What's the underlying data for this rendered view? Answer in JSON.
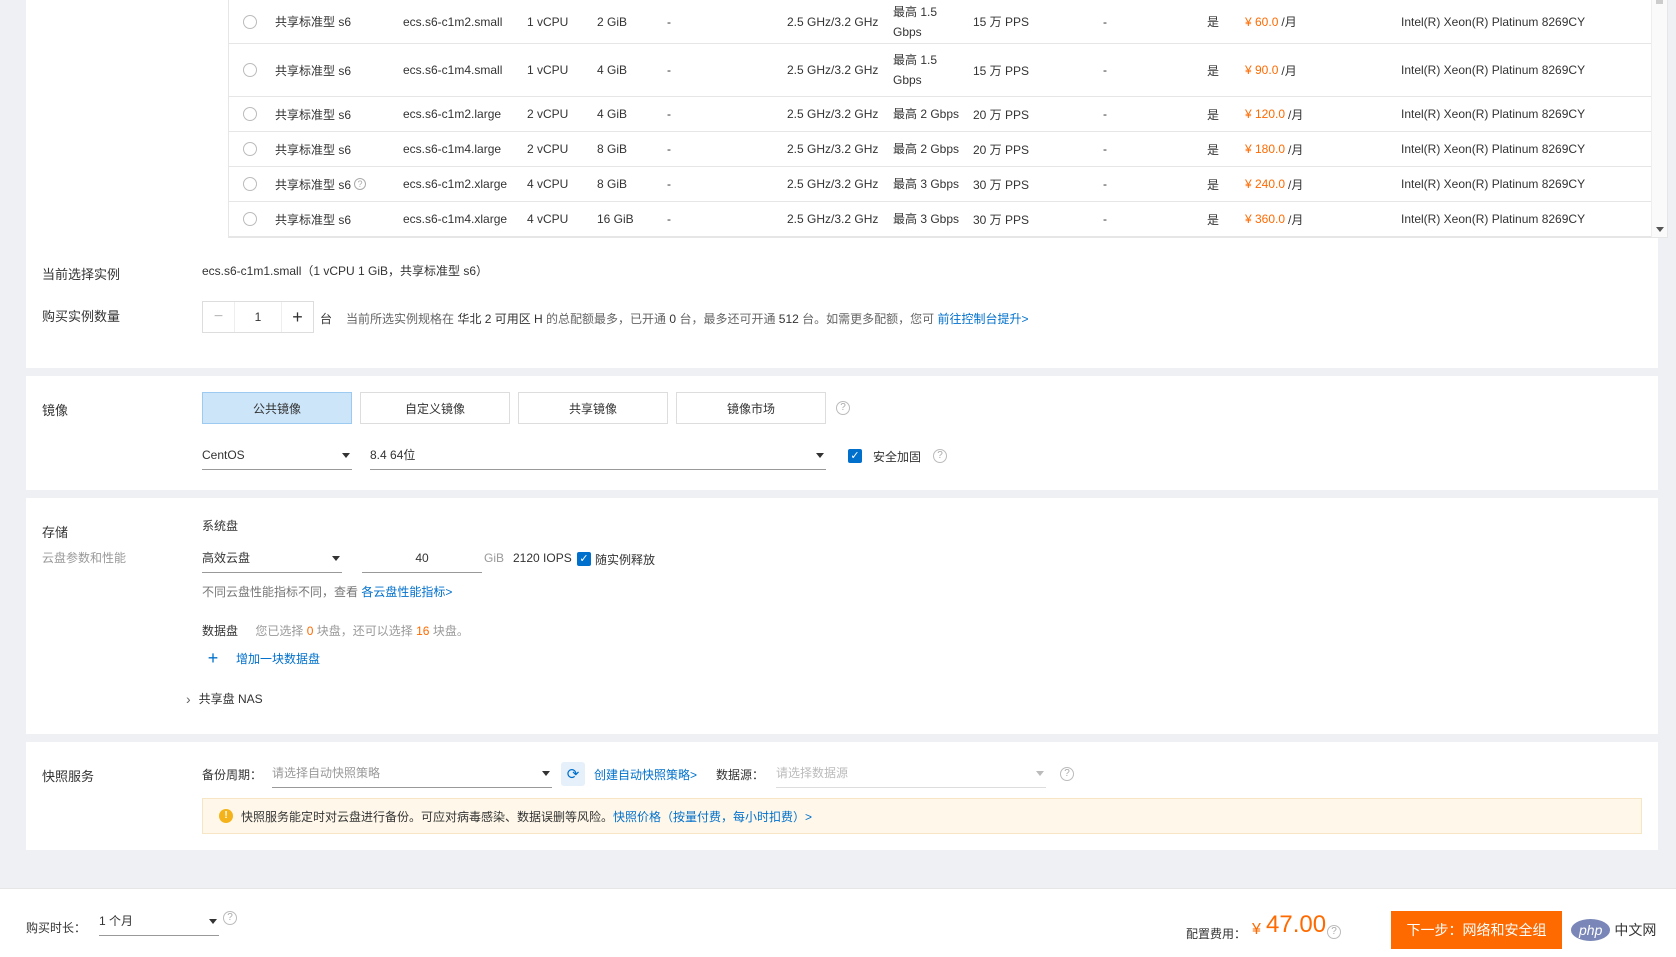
{
  "instances": [
    {
      "family": "共享标准型 s6",
      "spec": "ecs.s6-c1m2.small",
      "vcpu": "1 vCPU",
      "mem": "2 GiB",
      "gpu": "-",
      "freq": "2.5 GHz/3.2 GHz",
      "bw1": "最高 1.5",
      "bw2": "Gbps",
      "pps": "15 万 PPS",
      "ipv6": "-",
      "support": "是",
      "price": "¥ 60.0",
      "unit": "/月",
      "cpu": "Intel(R) Xeon(R) Platinum 8269CY",
      "help": false
    },
    {
      "family": "共享标准型 s6",
      "spec": "ecs.s6-c1m4.small",
      "vcpu": "1 vCPU",
      "mem": "4 GiB",
      "gpu": "-",
      "freq": "2.5 GHz/3.2 GHz",
      "bw1": "最高 1.5",
      "bw2": "Gbps",
      "pps": "15 万 PPS",
      "ipv6": "-",
      "support": "是",
      "price": "¥ 90.0",
      "unit": "/月",
      "cpu": "Intel(R) Xeon(R) Platinum 8269CY",
      "help": false
    },
    {
      "family": "共享标准型 s6",
      "spec": "ecs.s6-c1m2.large",
      "vcpu": "2 vCPU",
      "mem": "4 GiB",
      "gpu": "-",
      "freq": "2.5 GHz/3.2 GHz",
      "bw1": "最高 2 Gbps",
      "bw2": "",
      "pps": "20 万 PPS",
      "ipv6": "-",
      "support": "是",
      "price": "¥ 120.0",
      "unit": "/月",
      "cpu": "Intel(R) Xeon(R) Platinum 8269CY",
      "help": false
    },
    {
      "family": "共享标准型 s6",
      "spec": "ecs.s6-c1m4.large",
      "vcpu": "2 vCPU",
      "mem": "8 GiB",
      "gpu": "-",
      "freq": "2.5 GHz/3.2 GHz",
      "bw1": "最高 2 Gbps",
      "bw2": "",
      "pps": "20 万 PPS",
      "ipv6": "-",
      "support": "是",
      "price": "¥ 180.0",
      "unit": "/月",
      "cpu": "Intel(R) Xeon(R) Platinum 8269CY",
      "help": false
    },
    {
      "family": "共享标准型 s6",
      "spec": "ecs.s6-c1m2.xlarge",
      "vcpu": "4 vCPU",
      "mem": "8 GiB",
      "gpu": "-",
      "freq": "2.5 GHz/3.2 GHz",
      "bw1": "最高 3 Gbps",
      "bw2": "",
      "pps": "30 万 PPS",
      "ipv6": "-",
      "support": "是",
      "price": "¥ 240.0",
      "unit": "/月",
      "cpu": "Intel(R) Xeon(R) Platinum 8269CY",
      "help": true
    },
    {
      "family": "共享标准型 s6",
      "spec": "ecs.s6-c1m4.xlarge",
      "vcpu": "4 vCPU",
      "mem": "16 GiB",
      "gpu": "-",
      "freq": "2.5 GHz/3.2 GHz",
      "bw1": "最高 3 Gbps",
      "bw2": "",
      "pps": "30 万 PPS",
      "ipv6": "-",
      "support": "是",
      "price": "¥ 360.0",
      "unit": "/月",
      "cpu": "Intel(R) Xeon(R) Platinum 8269CY",
      "help": false
    }
  ],
  "current": {
    "label": "当前选择实例",
    "value": "ecs.s6-c1m1.small（1 vCPU 1 GiB，共享标准型 s6）"
  },
  "quantity": {
    "label": "购买实例数量",
    "value": "1",
    "minus": "−",
    "plus": "+",
    "unit": "台",
    "note_prefix": "当前所选实例规格在",
    "region": "华北 2 可用区 H",
    "note_mid1": "的总配额最多，已开通",
    "opened": "0",
    "note_mid2": "台，最多还可开通",
    "max": "512",
    "note_suffix": "台。如需更多配额，您可",
    "link": "前往控制台提升>"
  },
  "image": {
    "label": "镜像",
    "tabs": [
      "公共镜像",
      "自定义镜像",
      "共享镜像",
      "镜像市场"
    ],
    "os": "CentOS",
    "version": "8.4 64位",
    "security": "安全加固"
  },
  "storage": {
    "label": "存储",
    "sublabel": "云盘参数和性能",
    "system_disk": "系统盘",
    "disk_type": "高效云盘",
    "size": "40",
    "size_unit": "GiB",
    "iops": "2120 IOPS",
    "release": "随实例释放",
    "perf_note": "不同云盘性能指标不同，查看",
    "perf_link": "各云盘性能指标>",
    "data_disk": "数据盘",
    "dd_prefix": "您已选择",
    "dd_selected": "0",
    "dd_mid": "块盘，还可以选择",
    "dd_left": "16",
    "dd_suffix": "块盘。",
    "add_disk": "增加一块数据盘",
    "nas": "共享盘 NAS",
    "plus": "+",
    "chevron": "›"
  },
  "snapshot": {
    "label": "快照服务",
    "cycle_label": "备份周期：",
    "cycle_placeholder": "请选择自动快照策略",
    "create_link": "创建自动快照策略>",
    "source_label": "数据源：",
    "source_placeholder": "请选择数据源",
    "warn": "快照服务能定时对云盘进行备份。可应对病毒感染、数据误删等风险。",
    "price_link": "快照价格（按量付费，每小时扣费）>"
  },
  "footer": {
    "duration_label": "购买时长：",
    "duration": "1 个月",
    "fee_label": "配置费用：",
    "fee_currency": "¥",
    "fee": "47.00",
    "next": "下一步：网络和安全组",
    "brand": "php",
    "brand2": "中文网"
  },
  "icons": {
    "help": "?",
    "check": "✓",
    "refresh": "⟳",
    "warning": "!"
  },
  "colors": {
    "accent": "#0070cc",
    "orange": "#ff6a00",
    "tab_active": "#cce5f9",
    "warn_bg": "#fff8ea"
  }
}
